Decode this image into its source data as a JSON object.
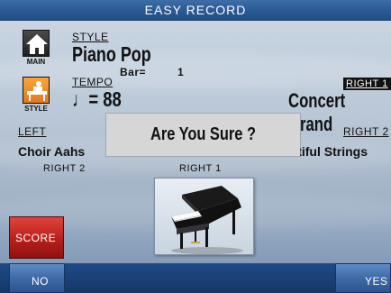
{
  "window": {
    "title": "EASY RECORD"
  },
  "nav": {
    "main_caption": "MAIN",
    "style_caption": "STYLE"
  },
  "style": {
    "label": "STYLE",
    "name": "Piano Pop",
    "bar_label": "Bar=",
    "bar_value": "1"
  },
  "tempo": {
    "label": "TEMPO",
    "symbol": "♩= 88"
  },
  "right1": {
    "badge": "RIGHT 1",
    "voice": "Concert Grand"
  },
  "left": {
    "label": "LEFT",
    "voice": "Choir Aahs",
    "sub": "RIGHT 2"
  },
  "right2": {
    "label": "RIGHT 2",
    "voice": "...utiful Strings"
  },
  "center": {
    "sub": "RIGHT 1"
  },
  "dialog": {
    "message": "Are You Sure ?"
  },
  "buttons": {
    "score": "SCORE",
    "no": "NO",
    "yes": "YES"
  },
  "icons": {
    "main": "house-icon",
    "style": "keyboard-player-icon",
    "piano": "grand-piano-image"
  },
  "colors": {
    "accent": "#2c5a94",
    "score": "#c42420",
    "style_icon": "#f39a33"
  }
}
